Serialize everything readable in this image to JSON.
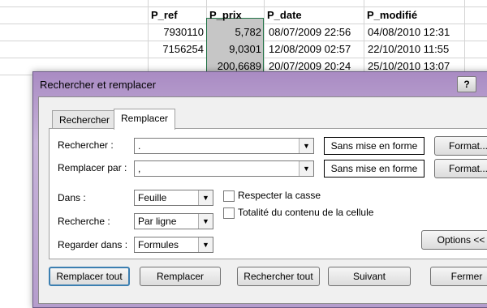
{
  "sheet": {
    "headers": [
      "P_ref",
      "P_prix",
      "P_date",
      "P_modifié"
    ],
    "rows": [
      [
        "7930110",
        "5,782",
        "08/07/2009 22:56",
        "04/08/2010 12:31"
      ],
      [
        "7156254",
        "9,0301",
        "12/08/2009 02:57",
        "22/10/2010 11:55"
      ],
      [
        "",
        "200,6689",
        "20/07/2009 20:24",
        "25/10/2010 13:07"
      ]
    ]
  },
  "dialog": {
    "title": "Rechercher et remplacer",
    "help": "?",
    "tabs": [
      "Rechercher",
      "Remplacer"
    ],
    "find_label": "Rechercher :",
    "find_value": ".",
    "replace_label": "Remplacer par :",
    "replace_value": ",",
    "no_format_1": "Sans mise en forme",
    "no_format_2": "Sans mise en forme",
    "format_1": "Format...",
    "format_2": "Format...",
    "within_label": "Dans :",
    "within_value": "Feuille",
    "search_label": "Recherche :",
    "search_value": "Par ligne",
    "lookin_label": "Regarder dans :",
    "lookin_value": "Formules",
    "match_case": "Respecter la casse",
    "match_entire": "Totalité du contenu de la cellule",
    "options": "Options <<",
    "buttons": {
      "replace_all": "Remplacer tout",
      "replace": "Remplacer",
      "find_all": "Rechercher tout",
      "find_next": "Suivant",
      "close": "Fermer"
    }
  }
}
